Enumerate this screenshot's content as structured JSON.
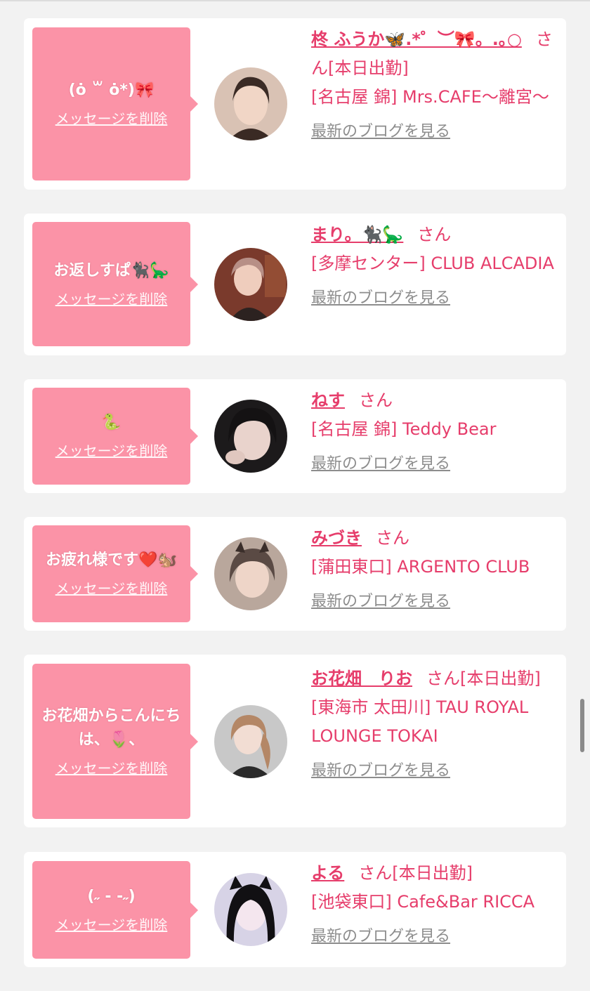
{
  "theme": {
    "bubble_color": "#fb93a7",
    "accent_color": "#e63d6b",
    "link_gray": "#8d8d8d",
    "background": "#f2f2f2"
  },
  "cards": [
    {
      "message": "(ȯ ꒳ ȯ*)🎀",
      "delete_label": "メッセージを削除",
      "name": "柊 ふうか🦋.*゜︶🎀。.｡○",
      "san": "さん",
      "attendance": "[本日出勤]",
      "shop": "[名古屋 錦] Mrs.CAFE〜離宮〜",
      "blog_label": "最新のブログを見る",
      "avatar_icon": "avatar-photo"
    },
    {
      "message": "お返しすぱ🐈‍⬛🦕",
      "delete_label": "メッセージを削除",
      "name": "まり。🐈‍⬛🦕",
      "san": "さん",
      "attendance": "",
      "shop": "[多摩センター] CLUB ALCADIA",
      "blog_label": "最新のブログを見る",
      "avatar_icon": "avatar-photo"
    },
    {
      "message": "🐍",
      "delete_label": "メッセージを削除",
      "name": "ねす",
      "san": "さん",
      "attendance": "",
      "shop": "[名古屋 錦] Teddy Bear",
      "blog_label": "最新のブログを見る",
      "avatar_icon": "avatar-photo"
    },
    {
      "message": "お疲れ様です❤️🐿️",
      "delete_label": "メッセージを削除",
      "name": "みづき",
      "san": "さん",
      "attendance": "",
      "shop": "[蒲田東口] ARGENTO CLUB",
      "blog_label": "最新のブログを見る",
      "avatar_icon": "avatar-photo"
    },
    {
      "message": "お花畑からこんにちは、🌷、",
      "delete_label": "メッセージを削除",
      "name": "お花畑　りお",
      "san": "さん",
      "attendance": "[本日出勤]",
      "shop": "[東海市 太田川] TAU ROYAL LOUNGE TOKAI",
      "blog_label": "最新のブログを見る",
      "avatar_icon": "avatar-photo"
    },
    {
      "message": "(˶ - -˶)",
      "delete_label": "メッセージを削除",
      "name": "よる",
      "san": "さん",
      "attendance": "[本日出勤]",
      "shop": "[池袋東口] Cafe&Bar RICCA",
      "blog_label": "最新のブログを見る",
      "avatar_icon": "avatar-photo"
    }
  ]
}
